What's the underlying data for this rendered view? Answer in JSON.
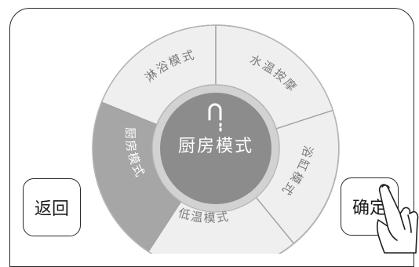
{
  "dial": {
    "segments": [
      {
        "id": "shower",
        "label": "淋浴模式"
      },
      {
        "id": "temp-massage",
        "label": "水温按摩"
      },
      {
        "id": "bathtub",
        "label": "浴缸模式"
      },
      {
        "id": "low-temp",
        "label": "低温模式"
      },
      {
        "id": "kitchen",
        "label": "厨房模式",
        "selected": true
      }
    ],
    "center": {
      "label": "厨房模式",
      "icon": "faucet-icon"
    }
  },
  "buttons": {
    "back": "返回",
    "confirm": "确定"
  },
  "colors": {
    "segment_fill": "#efefef",
    "segment_selected": "#a6a6a6",
    "center_fill": "#8c8c8c",
    "ring": "#c4c4c4"
  }
}
